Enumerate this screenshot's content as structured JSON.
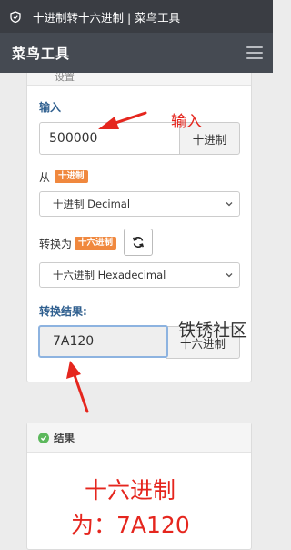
{
  "statusbar": {
    "title": "十进制转十六进制 | 菜鸟工具"
  },
  "navbar": {
    "brand": "菜鸟工具"
  },
  "settings": {
    "header_label": "设置"
  },
  "input": {
    "label": "输入",
    "value": "500000",
    "base_label": "十进制"
  },
  "from": {
    "label": "从",
    "badge": "十进制",
    "selected": "十进制 Decimal"
  },
  "to": {
    "label": "转换为",
    "badge": "十六进制",
    "selected": "十六进制 Hexadecimal"
  },
  "output": {
    "label": "转换结果:",
    "value": "7A120",
    "base_label": "十六进制"
  },
  "annotations": {
    "input_note": "输入",
    "watermark": "铁锈社区",
    "result_line1": "十六进制",
    "result_line2": "为：7A120"
  },
  "result": {
    "header_label": "结果"
  },
  "colors": {
    "accent_blue": "#2f5f8f",
    "badge_orange": "#f0883e",
    "annotation_red": "#e5261e",
    "nav_bg": "#454a52"
  }
}
